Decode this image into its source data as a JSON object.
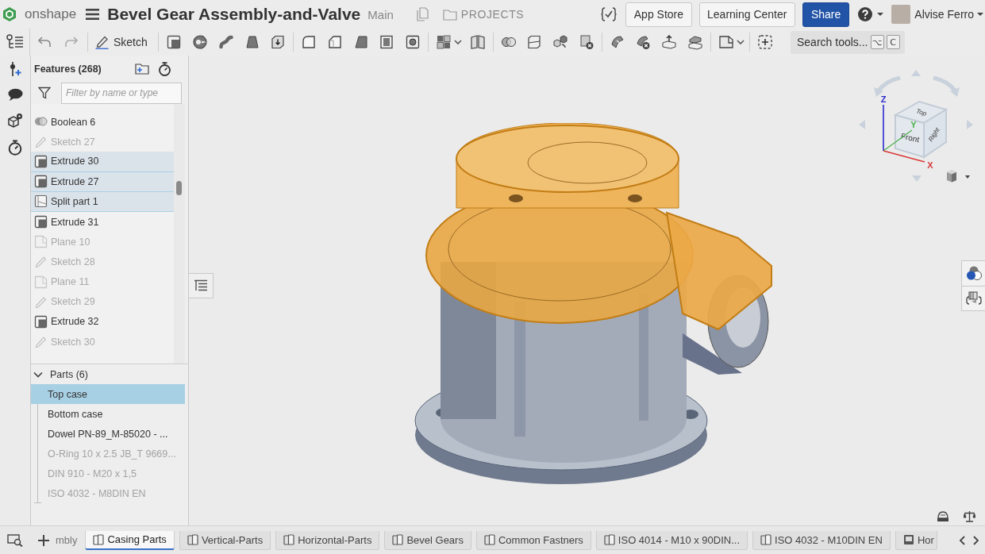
{
  "app": {
    "logo_text": "onshape"
  },
  "document": {
    "title": "Bevel Gear Assembly-and-Valve",
    "branch": "Main",
    "projects_link": "PROJECTS"
  },
  "header_buttons": [
    {
      "label": "App Store",
      "kind": "plain"
    },
    {
      "label": "Learning Center",
      "kind": "plain"
    },
    {
      "label": "Share",
      "kind": "primary"
    }
  ],
  "user": {
    "name": "Alvise Ferro"
  },
  "toolbar": {
    "sketch_button": "Sketch",
    "search_tools": {
      "label": "Search tools...",
      "keys": [
        "⌥",
        "C"
      ]
    }
  },
  "features_panel": {
    "title": "Features (268)",
    "filter": {
      "placeholder": "Filter by name or type"
    },
    "features": [
      {
        "name": "Boolean 6",
        "kind": "boolean",
        "hidden": false,
        "selected": false
      },
      {
        "name": "Sketch 27",
        "kind": "sketch",
        "hidden": true,
        "selected": false
      },
      {
        "name": "Extrude 30",
        "kind": "extrude",
        "hidden": false,
        "selected": true
      },
      {
        "name": "Extrude 27",
        "kind": "extrude",
        "hidden": false,
        "selected": true
      },
      {
        "name": "Split part 1",
        "kind": "split",
        "hidden": false,
        "selected": true
      },
      {
        "name": "Extrude 31",
        "kind": "extrude",
        "hidden": false,
        "selected": false
      },
      {
        "name": "Plane 10",
        "kind": "plane",
        "hidden": true,
        "selected": false
      },
      {
        "name": "Sketch 28",
        "kind": "sketch",
        "hidden": true,
        "selected": false
      },
      {
        "name": "Plane 11",
        "kind": "plane",
        "hidden": true,
        "selected": false
      },
      {
        "name": "Sketch 29",
        "kind": "sketch",
        "hidden": true,
        "selected": false
      },
      {
        "name": "Extrude 32",
        "kind": "extrude",
        "hidden": false,
        "selected": false
      },
      {
        "name": "Sketch 30",
        "kind": "sketch",
        "hidden": true,
        "selected": false
      }
    ],
    "parts_section": {
      "title": "Parts (6)",
      "expanded": true,
      "parts": [
        {
          "name": "Top case",
          "hidden": false,
          "selected": true
        },
        {
          "name": "Bottom case",
          "hidden": false,
          "selected": false
        },
        {
          "name": "Dowel PN-89_M-85020 - ...",
          "hidden": false,
          "selected": false
        },
        {
          "name": "O-Ring 10 x 2.5 JB_T 9669...",
          "hidden": true,
          "selected": false
        },
        {
          "name": "DIN 910 - M20 x 1,5",
          "hidden": true,
          "selected": false
        },
        {
          "name": "ISO 4032 - M8DIN EN",
          "hidden": true,
          "selected": false
        }
      ]
    }
  },
  "view_cube": {
    "faces": [
      "Top",
      "Front",
      "Right"
    ],
    "axes": [
      "Z",
      "Y",
      "X"
    ]
  },
  "tabs": [
    {
      "label": "mbly",
      "kind": "clipped",
      "selected": false
    },
    {
      "label": "Casing Parts",
      "kind": "part_studio",
      "selected": true
    },
    {
      "label": "Vertical-Parts",
      "kind": "part_studio",
      "selected": false
    },
    {
      "label": "Horizontal-Parts",
      "kind": "part_studio",
      "selected": false
    },
    {
      "label": "Bevel Gears",
      "kind": "part_studio",
      "selected": false
    },
    {
      "label": "Common Fastners",
      "kind": "part_studio",
      "selected": false
    },
    {
      "label": "ISO 4014 - M10 x 90DIN...",
      "kind": "part_studio",
      "selected": false
    },
    {
      "label": "ISO 4032 - M10DIN EN",
      "kind": "part_studio",
      "selected": false
    },
    {
      "label": "Hor",
      "kind": "drawing",
      "selected": false
    }
  ]
}
